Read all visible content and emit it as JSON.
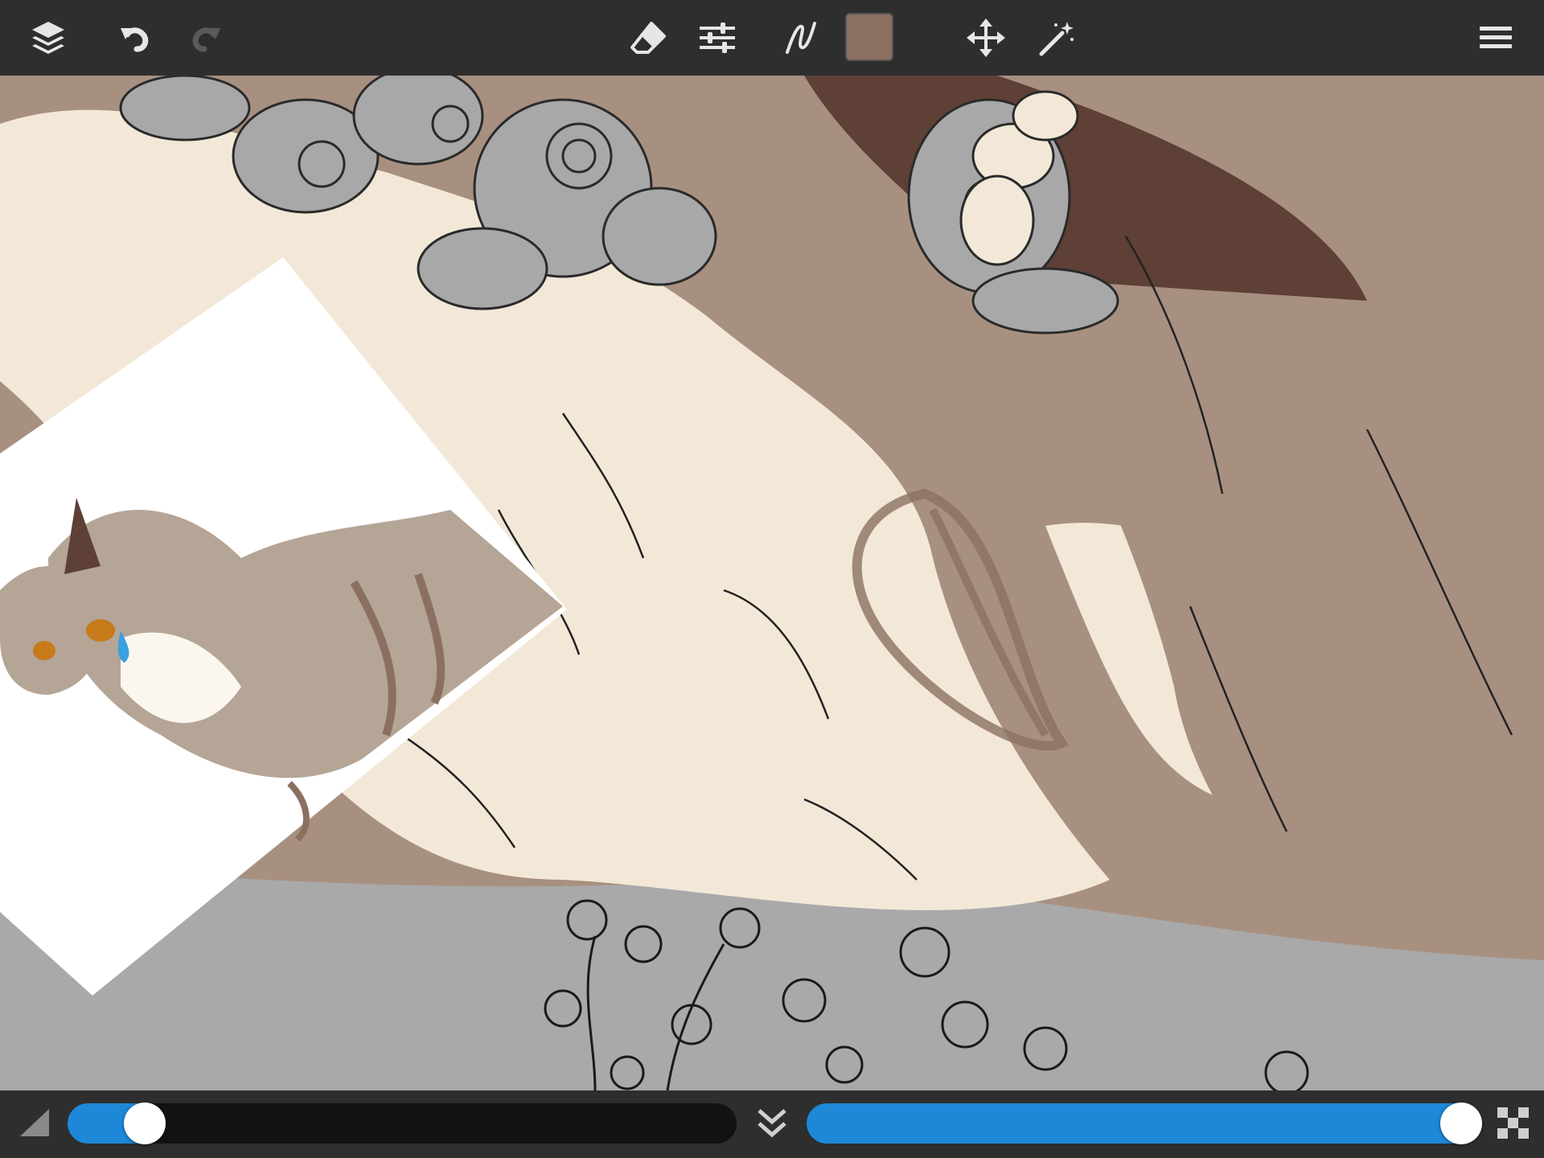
{
  "app": {
    "name": "drawing-app"
  },
  "toolbar": {
    "left": [
      {
        "name": "layers-button",
        "icon": "layers-icon"
      },
      {
        "name": "undo-button",
        "icon": "undo-icon"
      },
      {
        "name": "redo-button",
        "icon": "redo-icon",
        "enabled": false
      }
    ],
    "center": [
      {
        "name": "eraser-button",
        "icon": "eraser-icon"
      },
      {
        "name": "adjustments-button",
        "icon": "sliders-icon"
      },
      {
        "name": "brush-button",
        "icon": "brush-stroke-icon"
      },
      {
        "name": "color-swatch",
        "color": "#8b7062"
      },
      {
        "name": "transform-button",
        "icon": "move-icon"
      },
      {
        "name": "magic-wand-button",
        "icon": "magic-wand-icon"
      }
    ],
    "right": [
      {
        "name": "menu-button",
        "icon": "hamburger-menu-icon"
      }
    ]
  },
  "current_color": "#8b7062",
  "bottom_bar": {
    "brush_size": {
      "icon": "brush-size-icon",
      "fraction": 0.09,
      "color": "#1e88d8"
    },
    "layer_menu": {
      "icon": "double-chevron-down-icon"
    },
    "opacity": {
      "fraction": 1.0,
      "color": "#1e88d8"
    },
    "transparency": {
      "icon": "checkerboard-icon"
    }
  },
  "reference_image": {
    "description_icon": "cat-reference-icon"
  }
}
